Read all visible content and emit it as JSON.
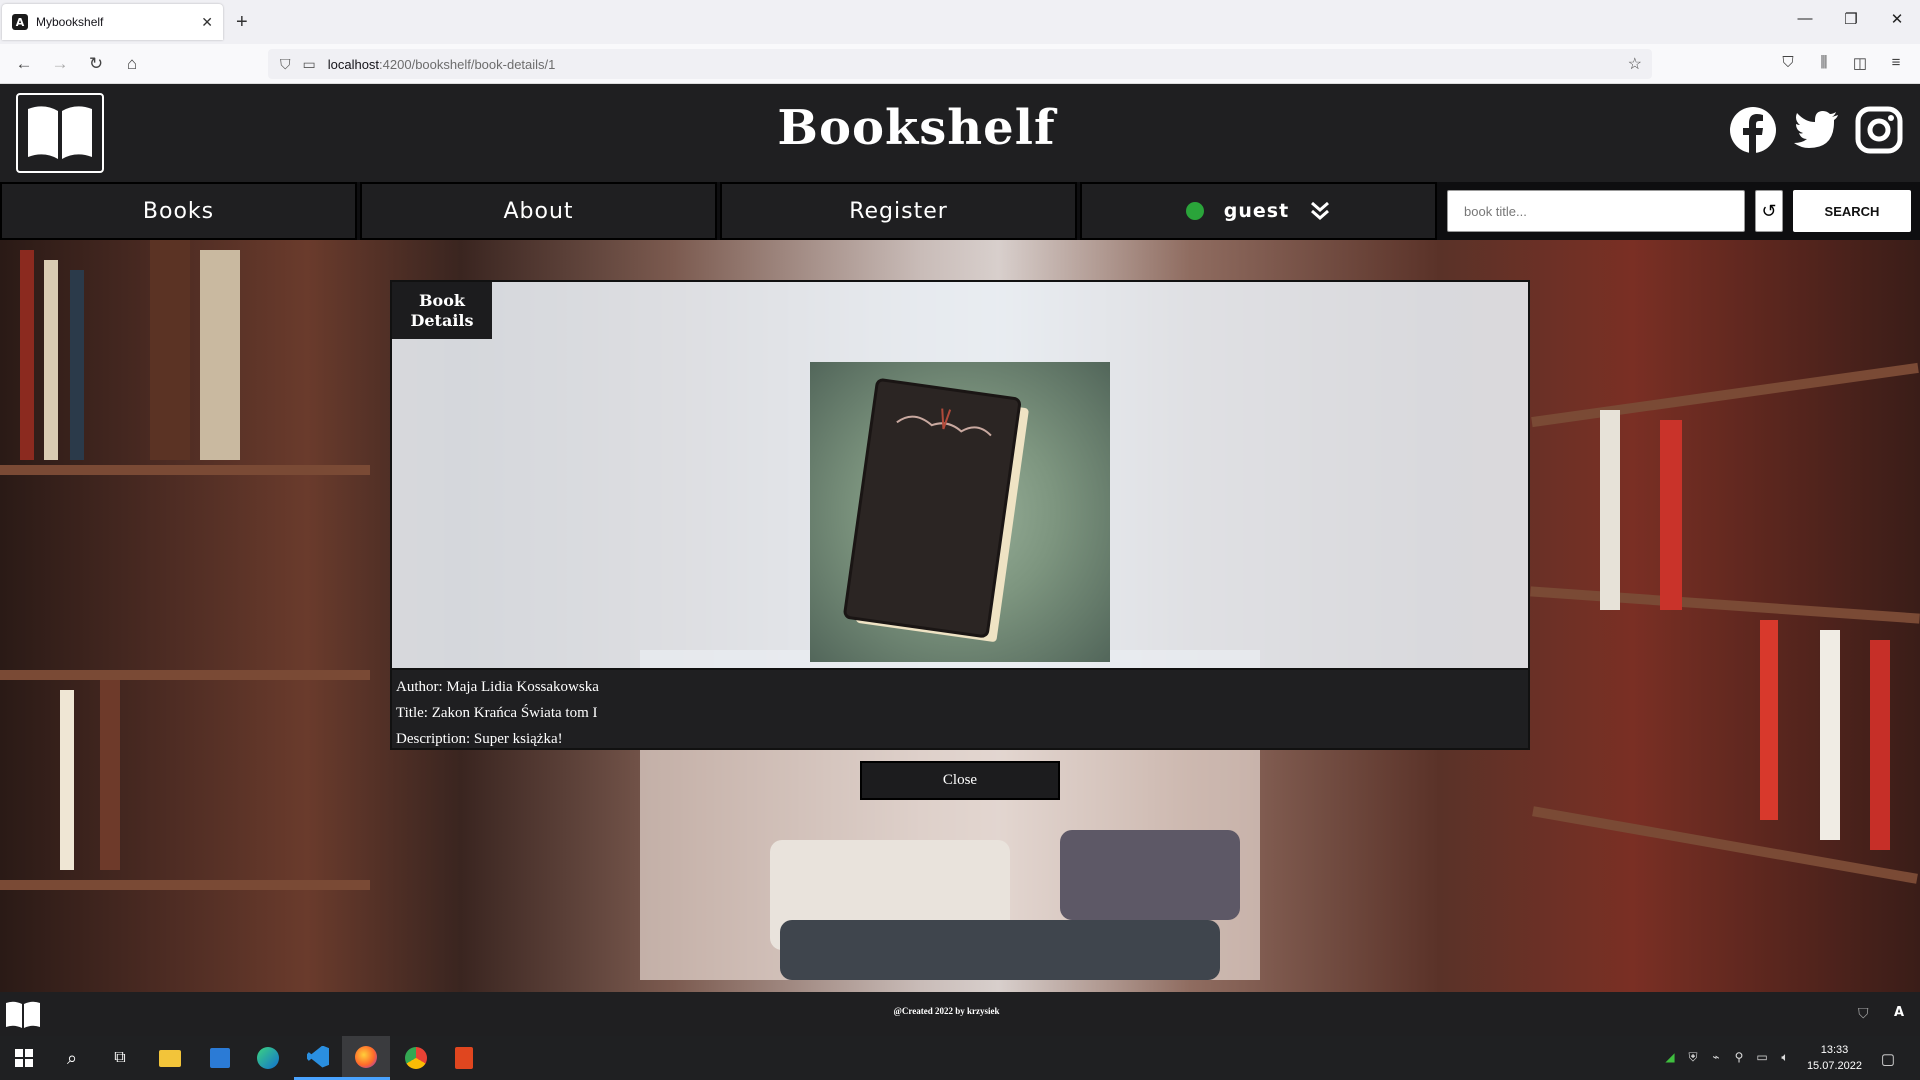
{
  "browser": {
    "tab_title": "Mybookshelf",
    "tab_favicon": "A",
    "url_host": "localhost",
    "url_path": ":4200/bookshelf/book-details/1"
  },
  "site": {
    "title": "Bookshelf",
    "social_icons": [
      "facebook-icon",
      "twitter-icon",
      "instagram-icon"
    ],
    "menu": {
      "books": "Books",
      "about": "About",
      "register": "Register",
      "user": "guest"
    },
    "search": {
      "placeholder": "book title...",
      "button_label": "SEARCH"
    }
  },
  "modal": {
    "badge_line1": "Book",
    "badge_line2": "Details",
    "author": "Author: Maja Lidia Kossakowska",
    "title": "Title: Zakon Krańca Świata tom I",
    "description": "Description: Super książka!",
    "close_label": "Close"
  },
  "footer": {
    "credit": "@Created 2022 by krzysiek"
  },
  "taskbar": {
    "time": "13:33",
    "date": "15.07.2022"
  },
  "colors": {
    "header_bg": "#1f1f21",
    "online_dot": "#2aa43a"
  }
}
